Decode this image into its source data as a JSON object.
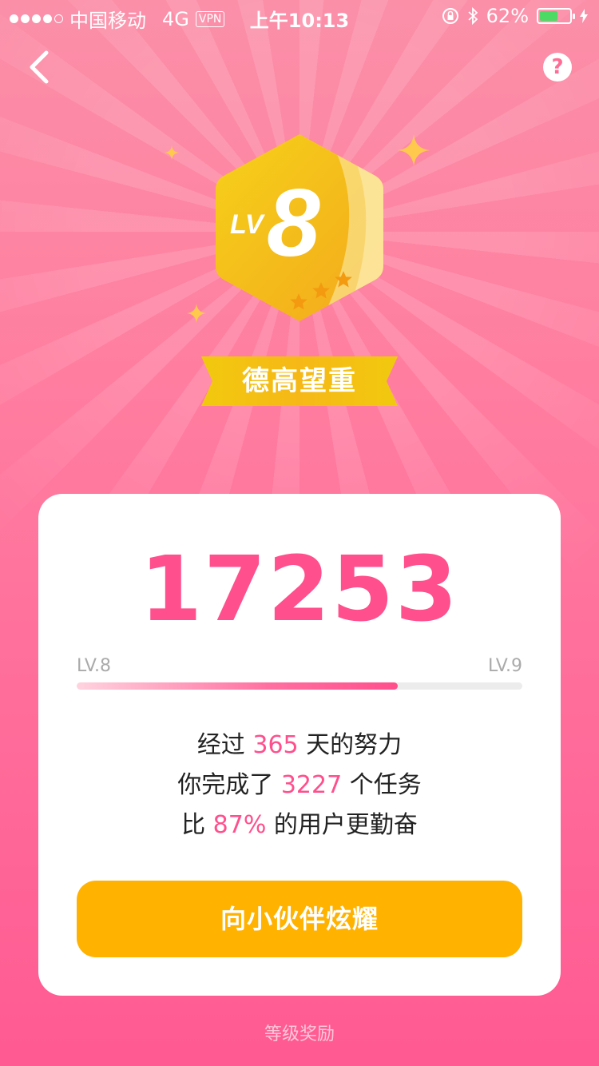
{
  "status_bar": {
    "carrier": "中国移动",
    "network": "4G",
    "vpn": "VPN",
    "time": "上午10:13",
    "battery_percent": "62%",
    "battery_level": 0.62
  },
  "header": {
    "back_icon": "chevron-left-icon",
    "help_label": "?"
  },
  "badge": {
    "prefix": "LV",
    "level": "8",
    "stars": 3,
    "title": "德高望重"
  },
  "card": {
    "score": "17253",
    "progress": {
      "from_label": "LV.8",
      "to_label": "LV.9",
      "fraction": 0.72
    },
    "line1": {
      "pre": "经过 ",
      "value": "365",
      "post": " 天的努力"
    },
    "line2": {
      "pre": "你完成了 ",
      "value": "3227",
      "post": " 个任务"
    },
    "line3": {
      "pre": "比 ",
      "value": "87%",
      "post": " 的用户更勤奋"
    },
    "cta_label": "向小伙伴炫耀"
  },
  "footer": {
    "link_label": "等级奖励"
  },
  "colors": {
    "accent": "#ff4f8c",
    "cta": "#ffb200",
    "badge": "#f8c11a"
  }
}
